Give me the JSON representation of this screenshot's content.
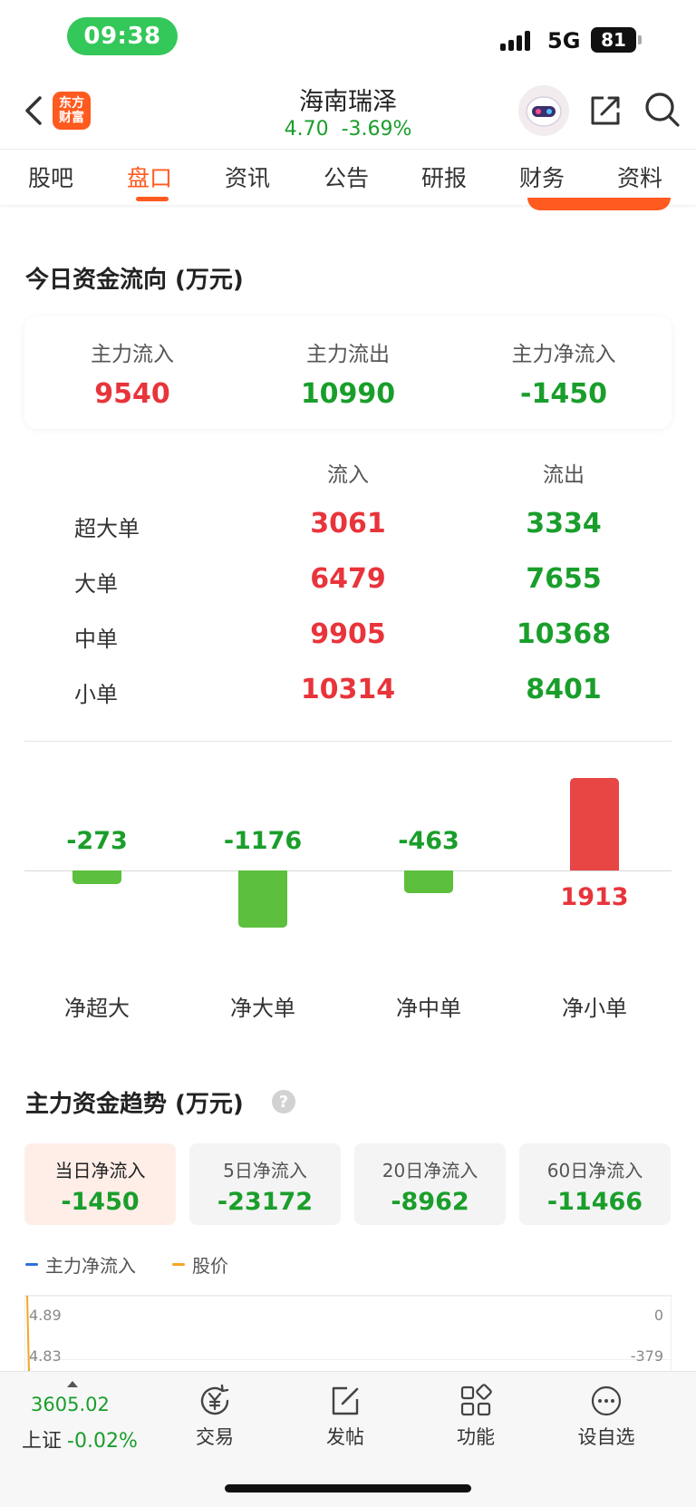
{
  "status_bar": {
    "time": "09:38",
    "network": "5G",
    "battery": "81"
  },
  "header": {
    "logo_line1": "东方",
    "logo_line2": "财富",
    "stock_name": "海南瑞泽",
    "price": "4.70",
    "change_pct": "-3.69%"
  },
  "tabs": [
    "股吧",
    "盘口",
    "资讯",
    "公告",
    "研报",
    "财务",
    "资料"
  ],
  "active_tab": "盘口",
  "fund_flow": {
    "title": "今日资金流向 (万元)",
    "summary": [
      {
        "label": "主力流入",
        "value": "9540",
        "color": "red"
      },
      {
        "label": "主力流出",
        "value": "10990",
        "color": "green"
      },
      {
        "label": "主力净流入",
        "value": "-1450",
        "color": "green"
      }
    ],
    "table": {
      "headers": [
        "流入",
        "流出"
      ],
      "rows": [
        {
          "label": "超大单",
          "inflow": "3061",
          "outflow": "3334"
        },
        {
          "label": "大单",
          "inflow": "6479",
          "outflow": "7655"
        },
        {
          "label": "中单",
          "inflow": "9905",
          "outflow": "10368"
        },
        {
          "label": "小单",
          "inflow": "10314",
          "outflow": "8401"
        }
      ]
    }
  },
  "chart_data": {
    "type": "bar",
    "categories": [
      "净超大",
      "净大单",
      "净中单",
      "净小单"
    ],
    "values": [
      -273,
      -1176,
      -463,
      1913
    ],
    "title": "",
    "xlabel": "",
    "ylabel": "",
    "positive_color": "#e84545",
    "negative_color": "#5cbf3d"
  },
  "trend": {
    "title": "主力资金趋势 (万元)",
    "tabs": [
      {
        "label": "当日净流入",
        "value": "-1450"
      },
      {
        "label": "5日净流入",
        "value": "-23172"
      },
      {
        "label": "20日净流入",
        "value": "-8962"
      },
      {
        "label": "60日净流入",
        "value": "-11466"
      }
    ],
    "active_tab": "当日净流入",
    "legend": [
      {
        "name": "主力净流入",
        "color": "#2f6fe0"
      },
      {
        "name": "股价",
        "color": "#f5a623"
      }
    ],
    "left_ticks": [
      "4.89",
      "4.83"
    ],
    "right_ticks": [
      "0",
      "-379"
    ]
  },
  "bottom_bar": {
    "index_value": "3605.02",
    "index_name": "上证",
    "index_change": "-0.02%",
    "items": [
      "交易",
      "发帖",
      "功能",
      "设自选"
    ]
  },
  "colors": {
    "accent": "#ff5a1f",
    "up": "#e8343b",
    "down": "#1a9e2b",
    "time_pill": "#34c759"
  }
}
